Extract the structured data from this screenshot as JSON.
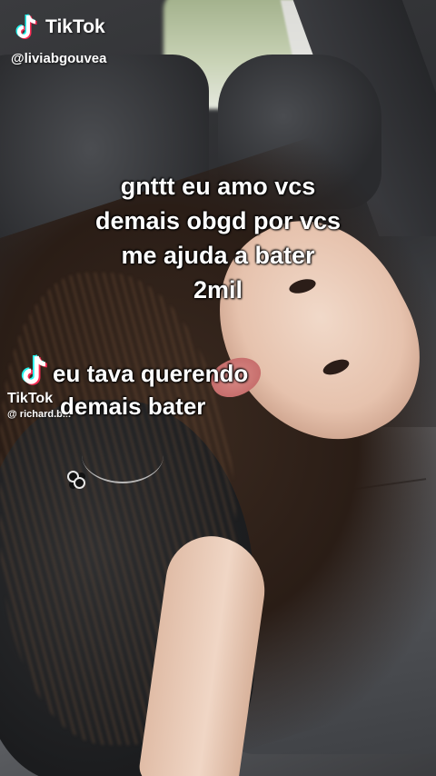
{
  "watermark": {
    "brand": "TikTok",
    "handle": "@liviabgouvea",
    "icon": "tiktok-logo-icon"
  },
  "overlay_caption": {
    "lines": [
      "gnttt eu amo vcs",
      "demais  obgd por vcs",
      "me ajuda   a bater",
      "2mil"
    ]
  },
  "inner_video": {
    "brand": "TikTok",
    "handle": "@ richard.b...",
    "caption_lines": [
      "eu tava  querendo",
      "demais bater"
    ],
    "icon": "tiktok-logo-icon"
  },
  "colors": {
    "caption_text": "#ffffff",
    "tiktok_cyan": "#25f4ee",
    "tiktok_red": "#fe2c55"
  }
}
